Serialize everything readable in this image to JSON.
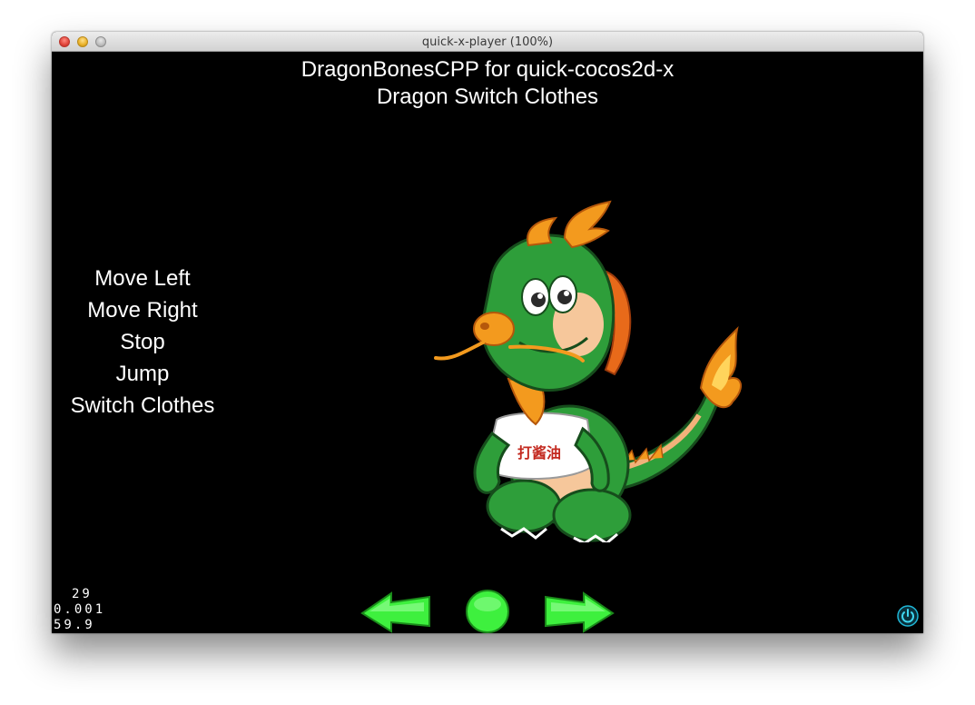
{
  "window": {
    "title": "quick-x-player (100%)"
  },
  "scene": {
    "title_line1": "DragonBonesCPP for quick-cocos2d-x",
    "title_line2": "Dragon Switch Clothes",
    "menu": [
      {
        "label": "Move Left"
      },
      {
        "label": "Move Right"
      },
      {
        "label": "Stop"
      },
      {
        "label": "Jump"
      },
      {
        "label": "Switch Clothes"
      }
    ],
    "stats": {
      "draw_calls": "29",
      "frame_time": "0.001",
      "fps": "59.9"
    },
    "shirt_text": "打酱油",
    "controls": {
      "left_icon": "left-arrow-icon",
      "center_icon": "circle-button-icon",
      "right_icon": "right-arrow-icon",
      "power_icon": "power-icon"
    },
    "colors": {
      "background": "#000000",
      "text": "#ffffff",
      "control_green": "#3ef03e",
      "dragon_green": "#2e9e3a",
      "dragon_orange": "#f39a1e"
    }
  }
}
